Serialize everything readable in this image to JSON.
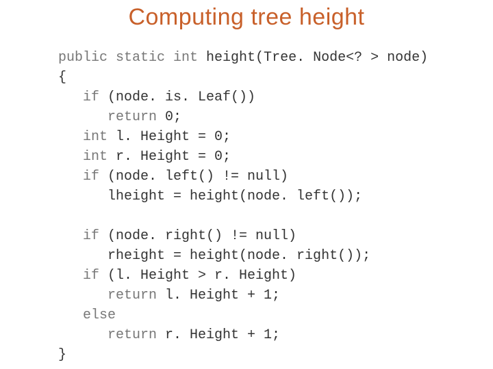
{
  "title": "Computing tree height",
  "code": {
    "l0_a": "public static int ",
    "l0_b": "height(Tree. Node<? > node)",
    "l1": "{",
    "l2_a": "   if ",
    "l2_b": "(node. is. Leaf())",
    "l3_a": "      return ",
    "l3_b": "0;",
    "l4_a": "   int ",
    "l4_b": "l. Height = 0;",
    "l5_a": "   int ",
    "l5_b": "r. Height = 0;",
    "l6_a": "   if ",
    "l6_b": "(node. left() != null)",
    "l7": "      lheight = height(node. left());",
    "l8": "",
    "l9_a": "   if ",
    "l9_b": "(node. right() != null)",
    "l10": "      rheight = height(node. right());",
    "l11_a": "   if ",
    "l11_b": "(l. Height > r. Height)",
    "l12_a": "      return ",
    "l12_b": "l. Height + 1;",
    "l13_a": "   else",
    "l14_a": "      return ",
    "l14_b": "r. Height + 1;",
    "l15": "}"
  }
}
